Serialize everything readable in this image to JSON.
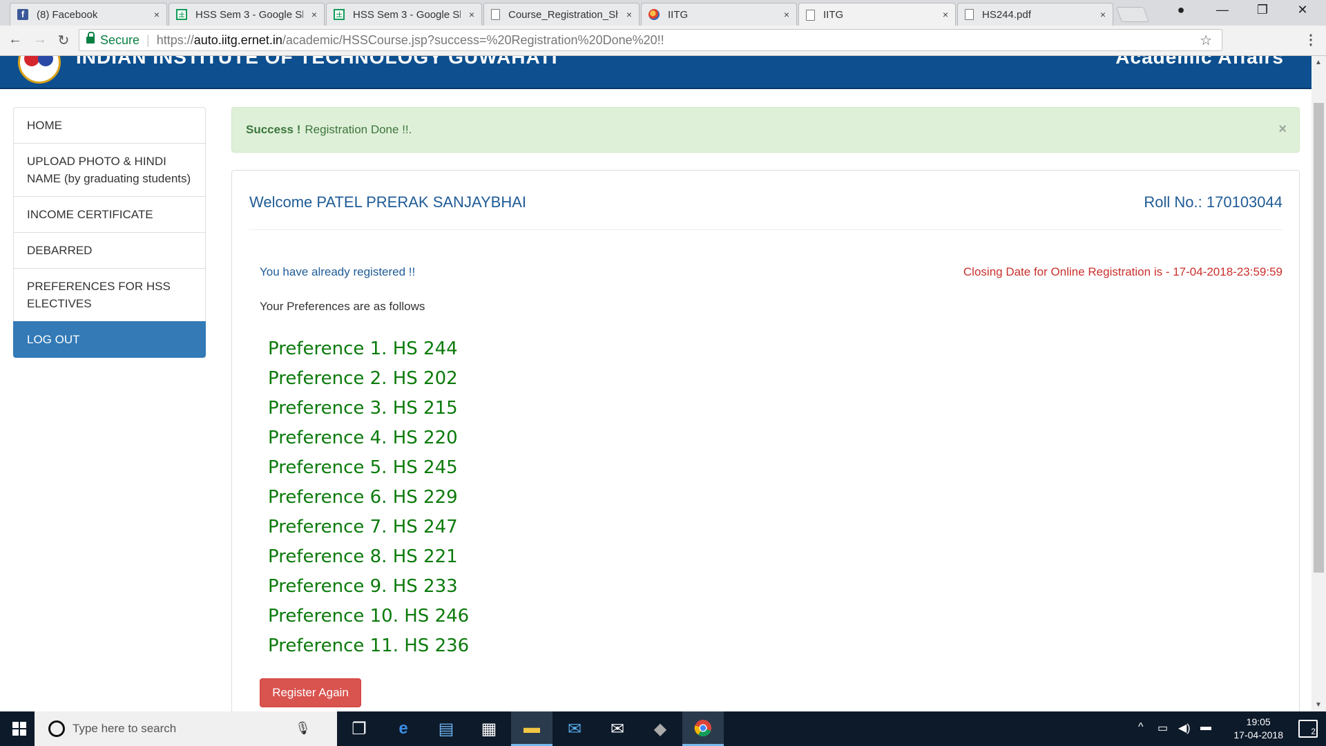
{
  "browser": {
    "tabs": [
      {
        "title": "(8) Facebook",
        "icon": "facebook-icon",
        "close": "×"
      },
      {
        "title": "HSS Sem 3 - Google Sh",
        "icon": "sheets-icon",
        "close": "×"
      },
      {
        "title": "HSS Sem 3 - Google Sh",
        "icon": "sheets-icon",
        "close": "×"
      },
      {
        "title": "Course_Registration_Sh",
        "icon": "document-icon",
        "close": "×"
      },
      {
        "title": "IITG",
        "icon": "site-icon",
        "close": "×"
      },
      {
        "title": "IITG",
        "icon": "document-icon",
        "close": "×",
        "active": true
      },
      {
        "title": "HS244.pdf",
        "icon": "document-icon",
        "close": "×"
      }
    ],
    "secure_label": "Secure",
    "url_scheme": "https://",
    "url_host": "auto.iitg.ernet.in",
    "url_path": "/academic/HSSCourse.jsp?success=%20Registration%20Done%20!!"
  },
  "header": {
    "title_cut_left": "INDIAN INSTITUTE OF TECHNOLOGY GUWAHATI",
    "title_cut_right": "Academic Affairs"
  },
  "sidebar": {
    "items": [
      {
        "label": "HOME"
      },
      {
        "label": "UPLOAD PHOTO & HINDI NAME (by graduating students)"
      },
      {
        "label": "INCOME CERTIFICATE"
      },
      {
        "label": "DEBARRED"
      },
      {
        "label": "PREFERENCES FOR HSS ELECTIVES"
      },
      {
        "label": "LOG OUT",
        "active": true
      }
    ]
  },
  "alert": {
    "strong": "Success !",
    "message": "Registration Done !!.",
    "close": "×"
  },
  "panel": {
    "welcome": "Welcome PATEL PRERAK SANJAYBHAI",
    "roll_no": "Roll No.: 170103044",
    "already_registered": "You have already registered !!",
    "closing_date": "Closing Date for Online Registration is - 17-04-2018-23:59:59",
    "preferences_label": "Your Preferences are as follows",
    "preferences": [
      "Preference 1. HS 244",
      "Preference 2. HS 202",
      "Preference 3. HS 215",
      "Preference 4. HS 220",
      "Preference 5. HS 245",
      "Preference 6. HS 229",
      "Preference 7. HS 247",
      "Preference 8. HS 221",
      "Preference 9. HS 233",
      "Preference 10. HS 246",
      "Preference 11. HS 236"
    ],
    "register_again": "Register Again"
  },
  "taskbar": {
    "search_placeholder": "Type here to search",
    "time": "19:05",
    "date": "17-04-2018",
    "notifications": "2"
  },
  "colors": {
    "header_blue": "#0d4f8f",
    "active_nav": "#337ab7",
    "success_bg": "#dff0d8",
    "preference_green": "#0b7a0b",
    "danger": "#d9534f"
  }
}
